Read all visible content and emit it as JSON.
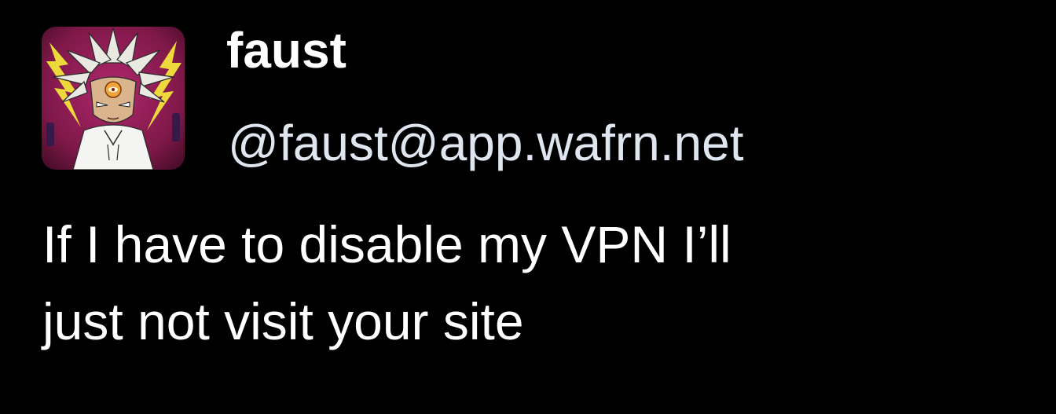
{
  "post": {
    "avatar_icon": "anime-character-avatar-icon",
    "display_name": "faust",
    "handle": "@faust@app.wafrn.net",
    "body_lines": [
      "If I have to disable my VPN I’ll",
      "just not visit your site"
    ]
  },
  "colors": {
    "background": "#000000",
    "name": "#ffffff",
    "handle": "#dfe6f0",
    "body": "#ffffff"
  }
}
